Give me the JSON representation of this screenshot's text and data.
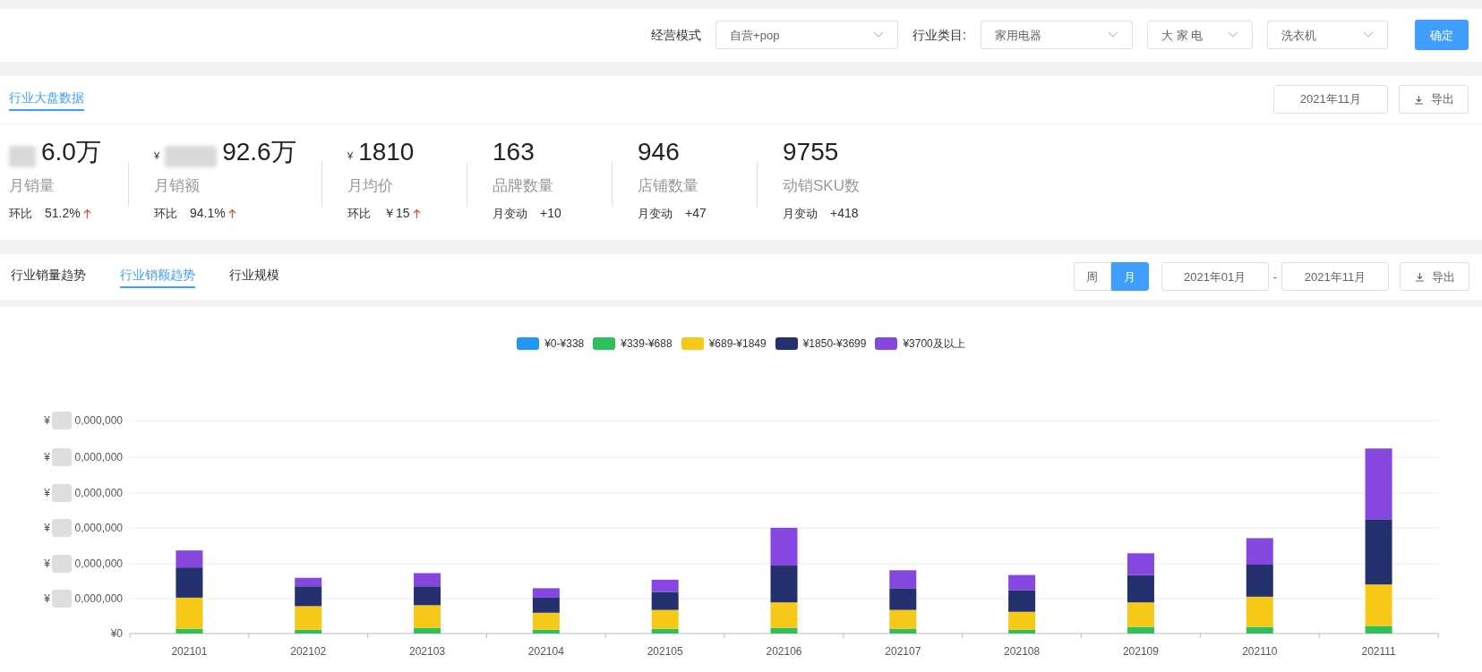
{
  "filters": [
    {
      "kind": "label",
      "text": "经营模式"
    },
    {
      "kind": "select",
      "value": "自营+pop"
    },
    {
      "kind": "label",
      "text": "行业类目:"
    },
    {
      "kind": "select",
      "value": "家用电器"
    },
    {
      "kind": "select",
      "value": "大 家 电"
    },
    {
      "kind": "select",
      "value": "洗衣机"
    }
  ],
  "confirm_button": "确定",
  "overview": {
    "title": "行业大盘数据",
    "date": "2021年11月",
    "export": "导出",
    "kpis": [
      {
        "redacted": true,
        "value": "6.0万",
        "label": "月销量",
        "change_label": "环比",
        "change": "51.2%",
        "rising": true
      },
      {
        "currency": "¥",
        "redacted": true,
        "value": "92.6万",
        "label": "月销额",
        "change_label": "环比",
        "change": "94.1%",
        "rising": true
      },
      {
        "currency": "¥",
        "redacted": false,
        "value": "1810",
        "label": "月均价",
        "change_label": "环比",
        "change": "￥15",
        "rising": true
      },
      {
        "redacted": false,
        "value": "163",
        "label": "品牌数量",
        "change_label": "月变动",
        "change": "+10",
        "rising": false
      },
      {
        "redacted": false,
        "value": "946",
        "label": "店铺数量",
        "change_label": "月变动",
        "change": "+47",
        "rising": false
      },
      {
        "redacted": false,
        "value": "9755",
        "label": "动销SKU数",
        "change_label": "月变动",
        "change": "+418",
        "rising": false
      }
    ]
  },
  "trend": {
    "tabs": [
      {
        "label": "行业销量趋势",
        "selected": false
      },
      {
        "label": "行业销额趋势",
        "selected": true
      },
      {
        "label": "行业规模",
        "selected": false
      }
    ],
    "period": [
      {
        "label": "周",
        "selected": false
      },
      {
        "label": "月",
        "selected": true
      }
    ],
    "date_from": "2021年01月",
    "date_separator": "-",
    "date_to": "2021年11月",
    "export": "导出"
  },
  "chart": {
    "legend": [
      {
        "label": "¥0-¥338",
        "color": "#2196f3"
      },
      {
        "label": "¥339-¥688",
        "color": "#2fbf5c"
      },
      {
        "label": "¥689-¥1849",
        "color": "#f6c918"
      },
      {
        "label": "¥1850-¥3699",
        "color": "#25306e"
      },
      {
        "label": "¥3700及以上",
        "color": "#8646e0"
      }
    ],
    "yticks": [
      {
        "prefix": "¥",
        "suffix": "0,000,000",
        "redacted": true
      },
      {
        "prefix": "¥",
        "suffix": "0,000,000",
        "redacted": true
      },
      {
        "prefix": "¥",
        "suffix": "0,000,000",
        "redacted": true
      },
      {
        "prefix": "¥",
        "suffix": "0,000,000",
        "redacted": true
      },
      {
        "prefix": "¥",
        "suffix": "0,000,000",
        "redacted": true
      },
      {
        "prefix": "¥",
        "suffix": "0,000,000",
        "redacted": true
      },
      {
        "prefix": "¥",
        "suffix": "0",
        "redacted": false
      }
    ],
    "categories": [
      "202101",
      "202102",
      "202103",
      "202104",
      "202105",
      "202106",
      "202107",
      "202108",
      "202109",
      "202110",
      "202111"
    ]
  }
}
